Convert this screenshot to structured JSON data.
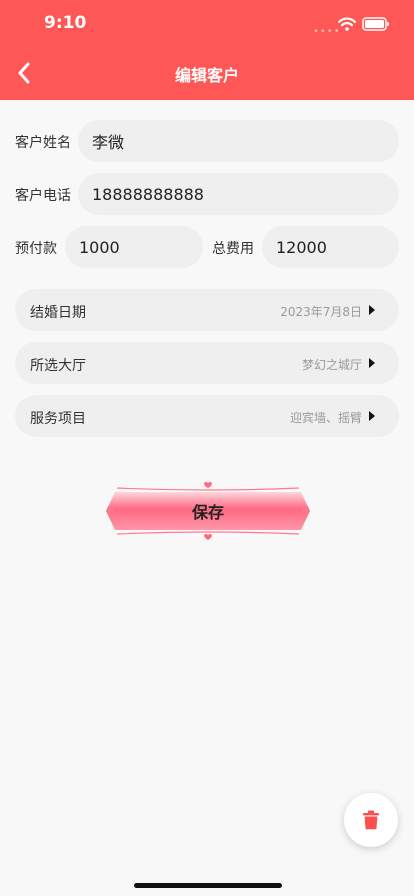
{
  "status_bar": {
    "time": "9:10",
    "dots": "••••"
  },
  "nav": {
    "title": "编辑客户"
  },
  "form": {
    "name": {
      "label": "客户姓名",
      "value": "李微"
    },
    "phone": {
      "label": "客户电话",
      "value": "18888888888"
    },
    "deposit": {
      "label": "预付款",
      "value": "1000"
    },
    "total": {
      "label": "总费用",
      "value": "12000"
    }
  },
  "selects": {
    "wedding_date": {
      "label": "结婚日期",
      "value": "2023年7月8日"
    },
    "hall": {
      "label": "所选大厅",
      "value": "梦幻之城厅"
    },
    "services": {
      "label": "服务项目",
      "value": "迎宾墙、摇臂"
    }
  },
  "save_button": {
    "label": "保存"
  },
  "colors": {
    "accent": "#ff5656",
    "field_bg": "#efefef",
    "delete": "#ff4e4e"
  },
  "icons": {
    "back": "chevron-left-icon",
    "delete": "trash-icon",
    "wifi": "wifi-icon",
    "battery": "battery-icon"
  }
}
